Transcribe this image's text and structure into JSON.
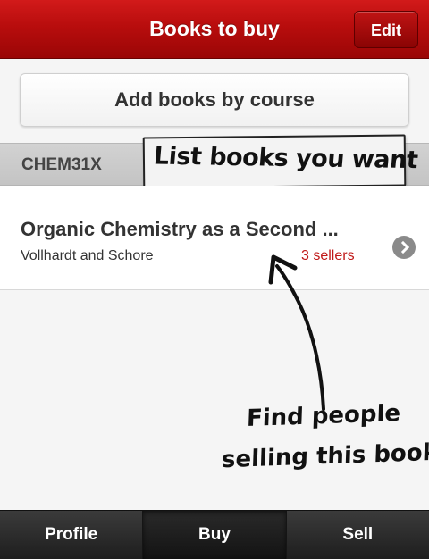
{
  "navbar": {
    "title": "Books to buy",
    "edit_label": "Edit"
  },
  "add_course_button": {
    "label": "Add books by course"
  },
  "section": {
    "header": "CHEM31X"
  },
  "callout": {
    "text": "List books you want"
  },
  "books": [
    {
      "title": "Organic Chemistry as a Second ...",
      "author": "Vollhardt and Schore",
      "sellers": "3 sellers",
      "chevron_icon": "chevron-right-circle-icon"
    }
  ],
  "annotation": {
    "line1": "Find people",
    "line2": "selling this book"
  },
  "tabbar": {
    "tabs": [
      {
        "label": "Profile",
        "active": false
      },
      {
        "label": "Buy",
        "active": true
      },
      {
        "label": "Sell",
        "active": false
      }
    ]
  },
  "colors": {
    "brand_red": "#b80d0d",
    "seller_count": "#c01818",
    "tabbar_dark": "#1e1e1e"
  }
}
